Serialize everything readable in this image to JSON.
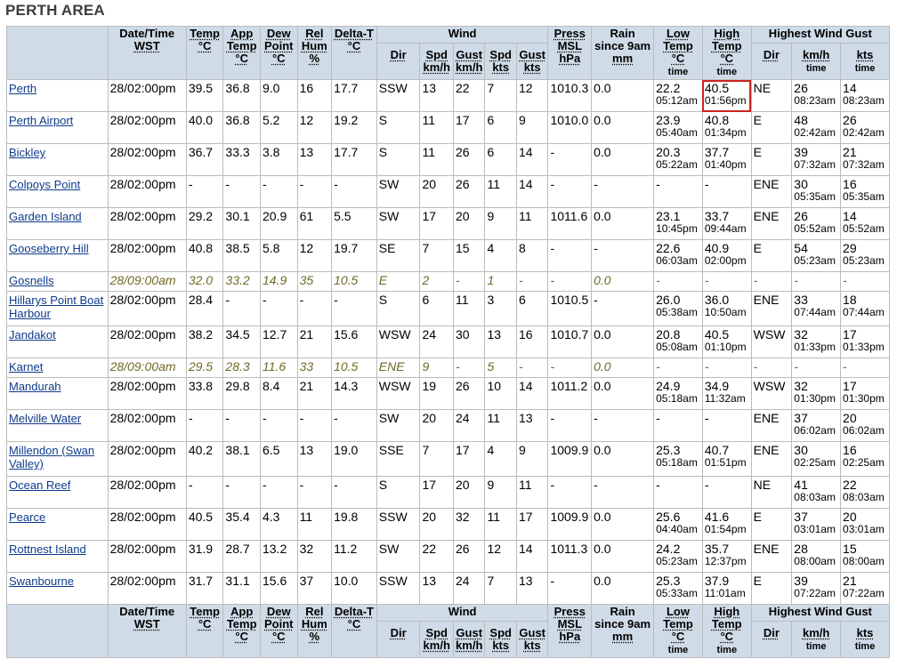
{
  "page": {
    "title": "PERTH AREA"
  },
  "headers": {
    "datetime": "Date/Time",
    "datetime_sub": "WST",
    "temp": "Temp",
    "temp_unit": "°C",
    "app_temp": "App Temp",
    "app_unit": "°C",
    "dew": "Dew Point",
    "dew_unit": "°C",
    "rel": "Rel Hum",
    "rel_unit": "%",
    "delta": "Delta-T",
    "delta_unit": "°C",
    "wind": "Wind",
    "wind_dir": "Dir",
    "wind_spd": "Spd",
    "wind_spd_unit": "km/h",
    "wind_gust": "Gust",
    "wind_gust_unit": "km/h",
    "wind_spd_kts": "Spd",
    "wind_spd_kts_unit": "kts",
    "wind_gust_kts": "Gust",
    "wind_gust_kts_unit": "kts",
    "press": "Press MSL",
    "press_unit": "hPa",
    "rain": "Rain since 9am",
    "rain_unit": "mm",
    "low": "Low Temp",
    "low_unit": "°C",
    "low_time": "time",
    "high": "High Temp",
    "high_unit": "°C",
    "high_time": "time",
    "gust": "Highest Wind Gust",
    "gust_dir": "Dir",
    "gust_kmh": "km/h",
    "gust_kmh_time": "time",
    "gust_kts": "kts",
    "gust_kts_time": "time"
  },
  "rows": [
    {
      "station": "Perth",
      "dt": "28/02:00pm",
      "temp": "39.5",
      "app": "36.8",
      "dew": "9.0",
      "rh": "16",
      "delta": "17.7",
      "dir": "SSW",
      "spd": "13",
      "gust": "22",
      "spdk": "7",
      "gustk": "12",
      "press": "1010.3",
      "rain": "0.0",
      "low": "22.2",
      "low_t": "05:12am",
      "high": "40.5",
      "high_t": "01:56pm",
      "gdir": "NE",
      "gkmh": "26",
      "gkmh_t": "08:23am",
      "gkts": "14",
      "gkts_t": "08:23am"
    },
    {
      "station": "Perth Airport",
      "dt": "28/02:00pm",
      "temp": "40.0",
      "app": "36.8",
      "dew": "5.2",
      "rh": "12",
      "delta": "19.2",
      "dir": "S",
      "spd": "11",
      "gust": "17",
      "spdk": "6",
      "gustk": "9",
      "press": "1010.0",
      "rain": "0.0",
      "low": "23.9",
      "low_t": "05:40am",
      "high": "40.8",
      "high_t": "01:34pm",
      "gdir": "E",
      "gkmh": "48",
      "gkmh_t": "02:42am",
      "gkts": "26",
      "gkts_t": "02:42am"
    },
    {
      "station": "Bickley",
      "dt": "28/02:00pm",
      "temp": "36.7",
      "app": "33.3",
      "dew": "3.8",
      "rh": "13",
      "delta": "17.7",
      "dir": "S",
      "spd": "11",
      "gust": "26",
      "spdk": "6",
      "gustk": "14",
      "press": "-",
      "rain": "0.0",
      "low": "20.3",
      "low_t": "05:22am",
      "high": "37.7",
      "high_t": "01:40pm",
      "gdir": "E",
      "gkmh": "39",
      "gkmh_t": "07:32am",
      "gkts": "21",
      "gkts_t": "07:32am"
    },
    {
      "station": "Colpoys Point",
      "dt": "28/02:00pm",
      "temp": "-",
      "app": "-",
      "dew": "-",
      "rh": "-",
      "delta": "-",
      "dir": "SW",
      "spd": "20",
      "gust": "26",
      "spdk": "11",
      "gustk": "14",
      "press": "-",
      "rain": "-",
      "low": "-",
      "low_t": "",
      "high": "-",
      "high_t": "",
      "gdir": "ENE",
      "gkmh": "30",
      "gkmh_t": "05:35am",
      "gkts": "16",
      "gkts_t": "05:35am"
    },
    {
      "station": "Garden Island",
      "dt": "28/02:00pm",
      "temp": "29.2",
      "app": "30.1",
      "dew": "20.9",
      "rh": "61",
      "delta": "5.5",
      "dir": "SW",
      "spd": "17",
      "gust": "20",
      "spdk": "9",
      "gustk": "11",
      "press": "1011.6",
      "rain": "0.0",
      "low": "23.1",
      "low_t": "10:45pm",
      "high": "33.7",
      "high_t": "09:44am",
      "gdir": "ENE",
      "gkmh": "26",
      "gkmh_t": "05:52am",
      "gkts": "14",
      "gkts_t": "05:52am"
    },
    {
      "station": "Gooseberry Hill",
      "dt": "28/02:00pm",
      "temp": "40.8",
      "app": "38.5",
      "dew": "5.8",
      "rh": "12",
      "delta": "19.7",
      "dir": "SE",
      "spd": "7",
      "gust": "15",
      "spdk": "4",
      "gustk": "8",
      "press": "-",
      "rain": "-",
      "low": "22.6",
      "low_t": "06:03am",
      "high": "40.9",
      "high_t": "02:00pm",
      "gdir": "E",
      "gkmh": "54",
      "gkmh_t": "05:23am",
      "gkts": "29",
      "gkts_t": "05:23am"
    },
    {
      "station": "Gosnells",
      "dt": "28/09:00am",
      "temp": "32.0",
      "app": "33.2",
      "dew": "14.9",
      "rh": "35",
      "delta": "10.5",
      "dir": "E",
      "spd": "2",
      "gust": "-",
      "spdk": "1",
      "gustk": "-",
      "press": "-",
      "rain": "0.0",
      "low": "-",
      "low_t": "",
      "high": "-",
      "high_t": "",
      "gdir": "-",
      "gkmh": "-",
      "gkmh_t": "",
      "gkts": "-",
      "gkts_t": "",
      "old": true
    },
    {
      "station": "Hillarys Point Boat Harbour",
      "dt": "28/02:00pm",
      "temp": "28.4",
      "app": "-",
      "dew": "-",
      "rh": "-",
      "delta": "-",
      "dir": "S",
      "spd": "6",
      "gust": "11",
      "spdk": "3",
      "gustk": "6",
      "press": "1010.5",
      "rain": "-",
      "low": "26.0",
      "low_t": "05:38am",
      "high": "36.0",
      "high_t": "10:50am",
      "gdir": "ENE",
      "gkmh": "33",
      "gkmh_t": "07:44am",
      "gkts": "18",
      "gkts_t": "07:44am"
    },
    {
      "station": "Jandakot",
      "dt": "28/02:00pm",
      "temp": "38.2",
      "app": "34.5",
      "dew": "12.7",
      "rh": "21",
      "delta": "15.6",
      "dir": "WSW",
      "spd": "24",
      "gust": "30",
      "spdk": "13",
      "gustk": "16",
      "press": "1010.7",
      "rain": "0.0",
      "low": "20.8",
      "low_t": "05:08am",
      "high": "40.5",
      "high_t": "01:10pm",
      "gdir": "WSW",
      "gkmh": "32",
      "gkmh_t": "01:33pm",
      "gkts": "17",
      "gkts_t": "01:33pm"
    },
    {
      "station": "Karnet",
      "dt": "28/09:00am",
      "temp": "29.5",
      "app": "28.3",
      "dew": "11.6",
      "rh": "33",
      "delta": "10.5",
      "dir": "ENE",
      "spd": "9",
      "gust": "-",
      "spdk": "5",
      "gustk": "-",
      "press": "-",
      "rain": "0.0",
      "low": "-",
      "low_t": "",
      "high": "-",
      "high_t": "",
      "gdir": "-",
      "gkmh": "-",
      "gkmh_t": "",
      "gkts": "-",
      "gkts_t": "",
      "old": true
    },
    {
      "station": "Mandurah",
      "dt": "28/02:00pm",
      "temp": "33.8",
      "app": "29.8",
      "dew": "8.4",
      "rh": "21",
      "delta": "14.3",
      "dir": "WSW",
      "spd": "19",
      "gust": "26",
      "spdk": "10",
      "gustk": "14",
      "press": "1011.2",
      "rain": "0.0",
      "low": "24.9",
      "low_t": "05:18am",
      "high": "34.9",
      "high_t": "11:32am",
      "gdir": "WSW",
      "gkmh": "32",
      "gkmh_t": "01:30pm",
      "gkts": "17",
      "gkts_t": "01:30pm"
    },
    {
      "station": "Melville Water",
      "dt": "28/02:00pm",
      "temp": "-",
      "app": "-",
      "dew": "-",
      "rh": "-",
      "delta": "-",
      "dir": "SW",
      "spd": "20",
      "gust": "24",
      "spdk": "11",
      "gustk": "13",
      "press": "-",
      "rain": "-",
      "low": "-",
      "low_t": "",
      "high": "-",
      "high_t": "",
      "gdir": "ENE",
      "gkmh": "37",
      "gkmh_t": "06:02am",
      "gkts": "20",
      "gkts_t": "06:02am"
    },
    {
      "station": "Millendon (Swan Valley)",
      "dt": "28/02:00pm",
      "temp": "40.2",
      "app": "38.1",
      "dew": "6.5",
      "rh": "13",
      "delta": "19.0",
      "dir": "SSE",
      "spd": "7",
      "gust": "17",
      "spdk": "4",
      "gustk": "9",
      "press": "1009.9",
      "rain": "0.0",
      "low": "25.3",
      "low_t": "05:18am",
      "high": "40.7",
      "high_t": "01:51pm",
      "gdir": "ENE",
      "gkmh": "30",
      "gkmh_t": "02:25am",
      "gkts": "16",
      "gkts_t": "02:25am"
    },
    {
      "station": "Ocean Reef",
      "dt": "28/02:00pm",
      "temp": "-",
      "app": "-",
      "dew": "-",
      "rh": "-",
      "delta": "-",
      "dir": "S",
      "spd": "17",
      "gust": "20",
      "spdk": "9",
      "gustk": "11",
      "press": "-",
      "rain": "-",
      "low": "-",
      "low_t": "",
      "high": "-",
      "high_t": "",
      "gdir": "NE",
      "gkmh": "41",
      "gkmh_t": "08:03am",
      "gkts": "22",
      "gkts_t": "08:03am"
    },
    {
      "station": "Pearce",
      "dt": "28/02:00pm",
      "temp": "40.5",
      "app": "35.4",
      "dew": "4.3",
      "rh": "11",
      "delta": "19.8",
      "dir": "SSW",
      "spd": "20",
      "gust": "32",
      "spdk": "11",
      "gustk": "17",
      "press": "1009.9",
      "rain": "0.0",
      "low": "25.6",
      "low_t": "04:40am",
      "high": "41.6",
      "high_t": "01:54pm",
      "gdir": "E",
      "gkmh": "37",
      "gkmh_t": "03:01am",
      "gkts": "20",
      "gkts_t": "03:01am"
    },
    {
      "station": "Rottnest Island",
      "dt": "28/02:00pm",
      "temp": "31.9",
      "app": "28.7",
      "dew": "13.2",
      "rh": "32",
      "delta": "11.2",
      "dir": "SW",
      "spd": "22",
      "gust": "26",
      "spdk": "12",
      "gustk": "14",
      "press": "1011.3",
      "rain": "0.0",
      "low": "24.2",
      "low_t": "05:23am",
      "high": "35.7",
      "high_t": "12:37pm",
      "gdir": "ENE",
      "gkmh": "28",
      "gkmh_t": "08:00am",
      "gkts": "15",
      "gkts_t": "08:00am"
    },
    {
      "station": "Swanbourne",
      "dt": "28/02:00pm",
      "temp": "31.7",
      "app": "31.1",
      "dew": "15.6",
      "rh": "37",
      "delta": "10.0",
      "dir": "SSW",
      "spd": "13",
      "gust": "24",
      "spdk": "7",
      "gustk": "13",
      "press": "-",
      "rain": "0.0",
      "low": "25.3",
      "low_t": "05:33am",
      "high": "37.9",
      "high_t": "11:01am",
      "gdir": "E",
      "gkmh": "39",
      "gkmh_t": "07:22am",
      "gkts": "21",
      "gkts_t": "07:22am"
    }
  ],
  "highlight": {
    "row": 0,
    "column": "high",
    "color": "#cc2222"
  }
}
